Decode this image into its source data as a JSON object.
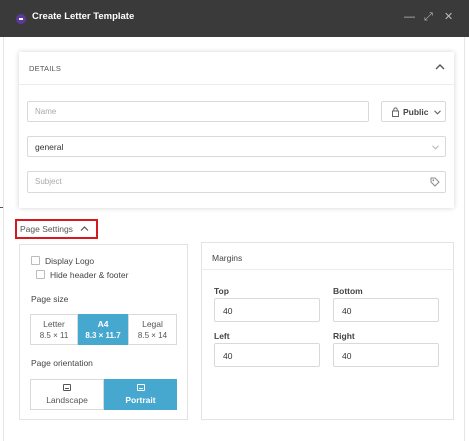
{
  "window": {
    "title": "Create Letter Template",
    "controls": {
      "minimize": "—",
      "maximize": "⤢",
      "close": "✕"
    }
  },
  "details": {
    "header": "DETAILS",
    "name_placeholder": "Name",
    "visibility": "Public",
    "category": "general",
    "subject_placeholder": "Subject"
  },
  "page_settings": {
    "toggle_label": "Page Settings",
    "display_logo": "Display Logo",
    "hide_header_footer": "Hide header & footer",
    "page_size_label": "Page size",
    "sizes": [
      {
        "name": "Letter",
        "dims": "8.5 × 11",
        "selected": false
      },
      {
        "name": "A4",
        "dims": "8.3 × 11.7",
        "selected": true
      },
      {
        "name": "Legal",
        "dims": "8.5 × 14",
        "selected": false
      }
    ],
    "orientation_label": "Page orientation",
    "orientations": [
      {
        "name": "Landscape",
        "selected": false
      },
      {
        "name": "Portrait",
        "selected": true
      }
    ]
  },
  "margins": {
    "title": "Margins",
    "top_label": "Top",
    "top_value": "40",
    "bottom_label": "Bottom",
    "bottom_value": "40",
    "left_label": "Left",
    "left_value": "40",
    "right_label": "Right",
    "right_value": "40"
  },
  "colors": {
    "accent": "#47a8cf",
    "highlight": "#d6191e",
    "titlebar": "#3a3a3a",
    "app_icon": "#5b3a9b"
  },
  "icons": [
    "app-icon",
    "minimize-icon",
    "maximize-icon",
    "close-icon",
    "chevron-up-icon",
    "lock-icon",
    "chevron-down-icon",
    "tag-icon",
    "image-icon"
  ]
}
